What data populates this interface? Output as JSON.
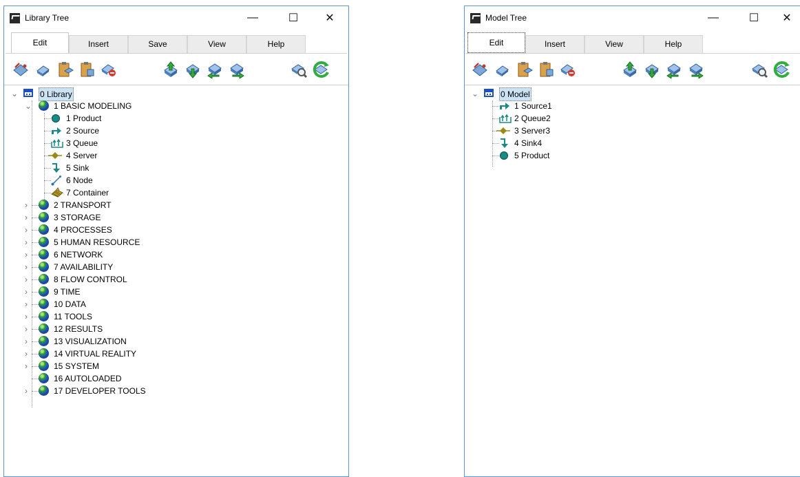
{
  "library_window": {
    "title": "Library Tree",
    "controls": {
      "minimize": "—",
      "maximize": "☐",
      "close": "✕"
    },
    "tabs": [
      {
        "label": "Edit",
        "active": true
      },
      {
        "label": "Insert",
        "active": false
      },
      {
        "label": "Save",
        "active": false
      },
      {
        "label": "View",
        "active": false
      },
      {
        "label": "Help",
        "active": false
      }
    ],
    "toolbar": [
      "cut-icon",
      "copy-icon",
      "paste-icon",
      "paste-special-icon",
      "delete-icon",
      "move-up-icon",
      "move-down-icon",
      "move-in-icon",
      "move-out-icon",
      "find-icon",
      "refresh-icon"
    ],
    "tree": {
      "root": {
        "label": "0 Library",
        "expanded": true,
        "selected": true
      },
      "groups": [
        {
          "label": "1 BASIC MODELING",
          "expanded": true,
          "children": [
            {
              "label": "1 Product",
              "icon": "product-icon"
            },
            {
              "label": "2 Source",
              "icon": "source-icon"
            },
            {
              "label": "3 Queue",
              "icon": "queue-icon"
            },
            {
              "label": "4 Server",
              "icon": "server-icon"
            },
            {
              "label": "5 Sink",
              "icon": "sink-icon"
            },
            {
              "label": "6 Node",
              "icon": "node-icon"
            },
            {
              "label": "7 Container",
              "icon": "container-icon"
            }
          ]
        },
        {
          "label": "2 TRANSPORT",
          "expanded": false
        },
        {
          "label": "3 STORAGE",
          "expanded": false
        },
        {
          "label": "4 PROCESSES",
          "expanded": false
        },
        {
          "label": "5 HUMAN RESOURCE",
          "expanded": false
        },
        {
          "label": "6 NETWORK",
          "expanded": false
        },
        {
          "label": "7 AVAILABILITY",
          "expanded": false
        },
        {
          "label": "8 FLOW CONTROL",
          "expanded": false
        },
        {
          "label": "9 TIME",
          "expanded": false
        },
        {
          "label": "10 DATA",
          "expanded": false
        },
        {
          "label": "11 TOOLS",
          "expanded": false
        },
        {
          "label": "12 RESULTS",
          "expanded": false
        },
        {
          "label": "13 VISUALIZATION",
          "expanded": false
        },
        {
          "label": "14 VIRTUAL REALITY",
          "expanded": false
        },
        {
          "label": "15 SYSTEM",
          "expanded": false
        },
        {
          "label": "16 AUTOLOADED",
          "expanded": false
        },
        {
          "label": "17 DEVELOPER TOOLS",
          "expanded": false
        }
      ]
    }
  },
  "model_window": {
    "title": "Model Tree",
    "controls": {
      "minimize": "—",
      "maximize": "☐",
      "close": "✕"
    },
    "tabs": [
      {
        "label": "Edit",
        "active": true
      },
      {
        "label": "Insert",
        "active": false
      },
      {
        "label": "View",
        "active": false
      },
      {
        "label": "Help",
        "active": false
      }
    ],
    "toolbar": [
      "cut-icon",
      "copy-icon",
      "paste-icon",
      "paste-special-icon",
      "delete-icon",
      "move-up-icon",
      "move-down-icon",
      "move-in-icon",
      "move-out-icon",
      "find-icon",
      "refresh-icon"
    ],
    "tree": {
      "root": {
        "label": "0 Model",
        "expanded": true,
        "selected": true
      },
      "children": [
        {
          "label": "1 Source1",
          "icon": "source-icon"
        },
        {
          "label": "2 Queue2",
          "icon": "queue-icon"
        },
        {
          "label": "3 Server3",
          "icon": "server-icon"
        },
        {
          "label": "4 Sink4",
          "icon": "sink-icon"
        },
        {
          "label": "5 Product",
          "icon": "product-icon"
        }
      ]
    }
  },
  "colors": {
    "window_border": "#5a95d6",
    "selection": "#cce3f5",
    "teal": "#1a8a86",
    "server_gold": "#9a8a12"
  }
}
